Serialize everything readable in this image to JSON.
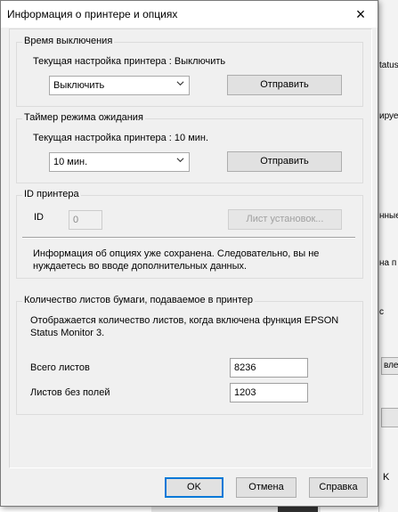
{
  "dialog": {
    "title": "Информация о принтере и опциях"
  },
  "power_off": {
    "legend": "Время выключения",
    "current_setting": "Текущая настройка принтера : Выключить",
    "select_value": "Выключить",
    "send_label": "Отправить"
  },
  "sleep_timer": {
    "legend": "Таймер режима ожидания",
    "current_setting": "Текущая настройка принтера : 10 мин.",
    "select_value": "10 мин.",
    "send_label": "Отправить"
  },
  "printer_id": {
    "legend": "ID принтера",
    "id_label": "ID",
    "id_value": "0",
    "sheet_button_label": "Лист установок...",
    "info_text": "Информация об опциях уже сохранена. Следовательно, вы не нуждаетесь во вводе дополнительных данных."
  },
  "paper_count": {
    "legend": "Количество листов бумаги, подаваемое в принтер",
    "description": "Отображается количество листов, когда включена функция EPSON Status Monitor 3.",
    "total_label": "Всего листов",
    "total_value": "8236",
    "borderless_label": "Листов без полей",
    "borderless_value": "1203"
  },
  "footer": {
    "ok_label": "OK",
    "cancel_label": "Отмена",
    "help_label": "Справка"
  },
  "background_window": {
    "fragments": [
      "tatus",
      "ируе",
      "нные",
      "на п",
      "с",
      "вле",
      "K"
    ]
  }
}
